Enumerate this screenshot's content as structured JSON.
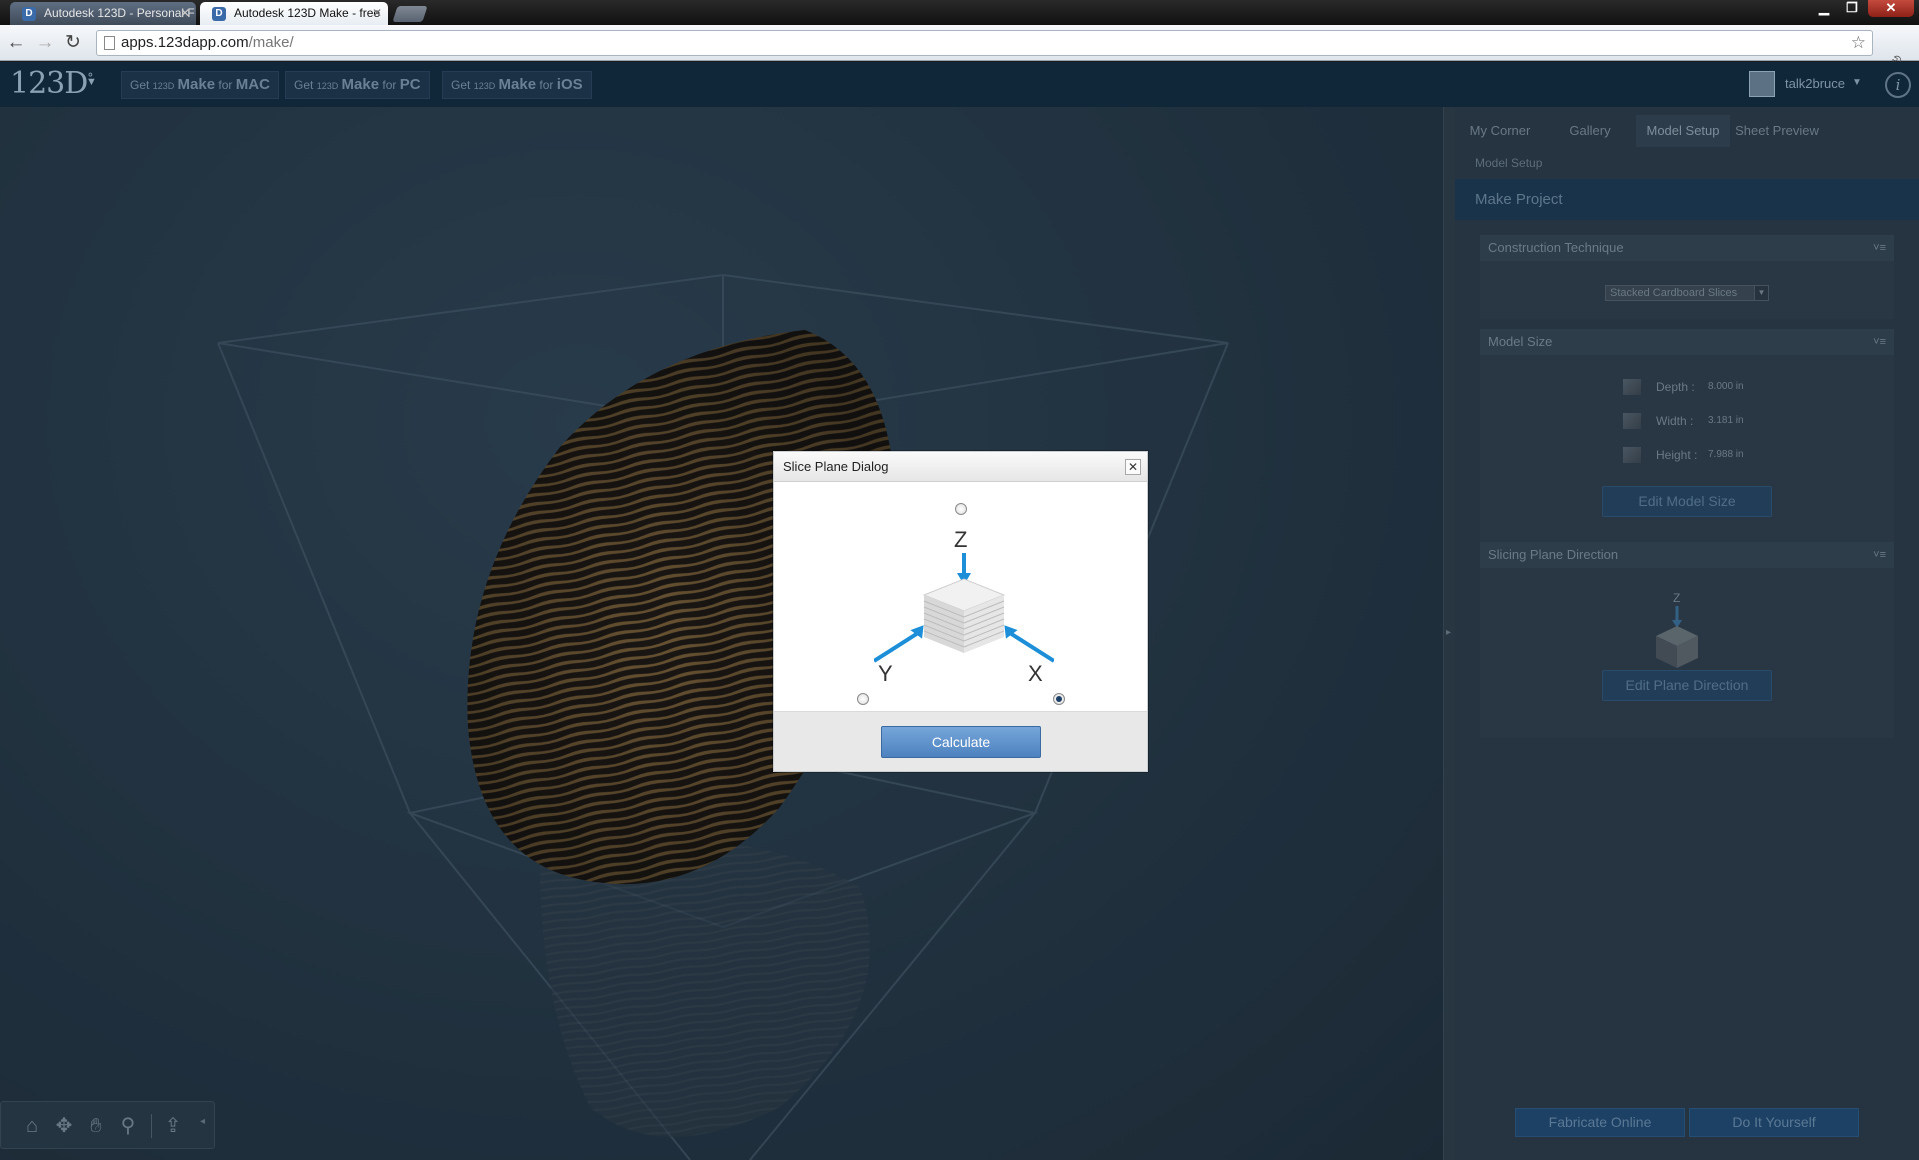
{
  "browser": {
    "tabs": [
      {
        "title": "Autodesk 123D - Personal F",
        "favicon": "123d-favicon"
      },
      {
        "title": "Autodesk 123D Make - free",
        "favicon": "123d-favicon"
      }
    ],
    "url_host": "apps.123dapp.com",
    "url_path": "/make/"
  },
  "header": {
    "logo": "123D",
    "logo_superscript": "°",
    "get_buttons": [
      {
        "prefix": "Get",
        "brand": "123D",
        "product": "Make",
        "for": "for",
        "platform": "MAC"
      },
      {
        "prefix": "Get",
        "brand": "123D",
        "product": "Make",
        "for": "for",
        "platform": "PC"
      },
      {
        "prefix": "Get",
        "brand": "123D",
        "product": "Make",
        "for": "for",
        "platform": "iOS"
      }
    ],
    "username": "talk2bruce",
    "info_glyph": "i"
  },
  "panel": {
    "tabs": [
      "My Corner",
      "Gallery",
      "Model Setup",
      "Sheet Preview"
    ],
    "active_tab": "Model Setup",
    "breadcrumb": "Model Setup",
    "project_title": "Make Project",
    "construction": {
      "title": "Construction Technique",
      "selected": "Stacked Cardboard Slices"
    },
    "model_size": {
      "title": "Model Size",
      "rows": [
        {
          "label": "Depth :",
          "value": "8.000 in"
        },
        {
          "label": "Width :",
          "value": "3.181 in"
        },
        {
          "label": "Height :",
          "value": "7.988 in"
        }
      ],
      "edit_button": "Edit Model Size"
    },
    "slicing": {
      "title": "Slicing Plane Direction",
      "axis": "Z",
      "edit_button": "Edit Plane Direction"
    },
    "section_controls": "˅≡",
    "footer_buttons": [
      "Fabricate Online",
      "Do It Yourself"
    ]
  },
  "dialog": {
    "title": "Slice Plane Dialog",
    "close_glyph": "✕",
    "axes": {
      "z": "Z",
      "y": "Y",
      "x": "X"
    },
    "selected_axis": "X",
    "calculate_label": "Calculate"
  },
  "colors": {
    "app_header": "#10273a",
    "viewport": "#2b3f51",
    "model_brown": "#6e5430",
    "dialog_button": "#5b8ecb",
    "axis_arrow": "#1c8fd8"
  }
}
